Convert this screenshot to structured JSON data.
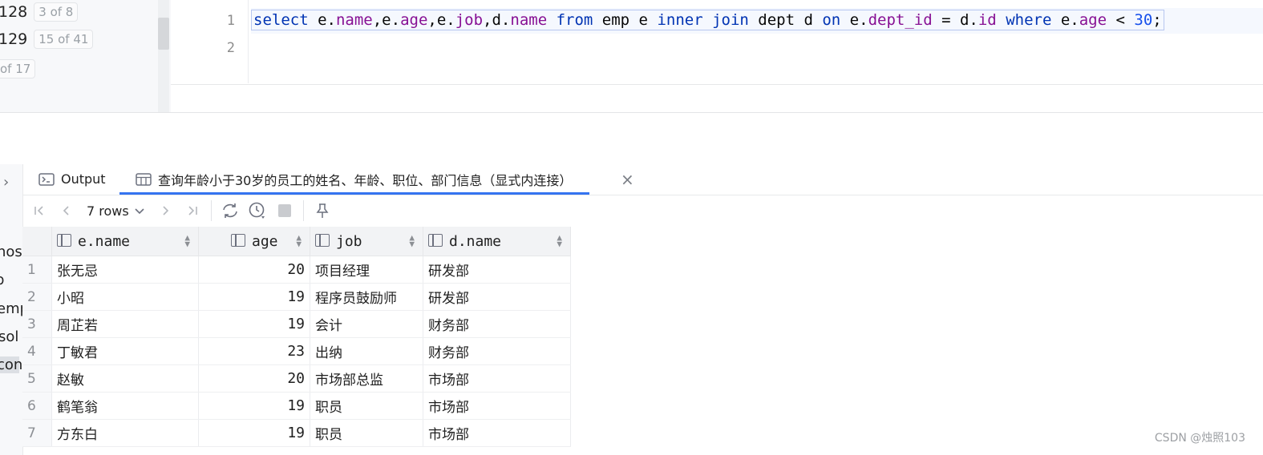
{
  "history": [
    {
      "num": "128",
      "badge": "3 of 8"
    },
    {
      "num": "129",
      "badge": "15 of 41"
    },
    {
      "num": "",
      "badge": "of 17"
    }
  ],
  "editor": {
    "line_numbers": [
      "1",
      "2"
    ]
  },
  "tabs": {
    "output_label": "Output",
    "result_label": "查询年龄小于30岁的员工的姓名、年龄、职位、部门信息（显式内连接）",
    "close_symbol": "×"
  },
  "toolbar": {
    "rows_label": "7 rows"
  },
  "tree_fragments": [
    "hos",
    "p",
    "emp",
    "sol",
    "cons"
  ],
  "table": {
    "columns": [
      "e.name",
      "age",
      "job",
      "d.name"
    ],
    "rows": [
      {
        "n": "1",
        "name": "张无忌",
        "age": "20",
        "job": "项目经理",
        "dept": "研发部"
      },
      {
        "n": "2",
        "name": "小昭",
        "age": "19",
        "job": "程序员鼓励师",
        "dept": "研发部"
      },
      {
        "n": "3",
        "name": "周芷若",
        "age": "19",
        "job": "会计",
        "dept": "财务部"
      },
      {
        "n": "4",
        "name": "丁敏君",
        "age": "23",
        "job": "出纳",
        "dept": "财务部"
      },
      {
        "n": "5",
        "name": "赵敏",
        "age": "20",
        "job": "市场部总监",
        "dept": "市场部"
      },
      {
        "n": "6",
        "name": "鹤笔翁",
        "age": "19",
        "job": "职员",
        "dept": "市场部"
      },
      {
        "n": "7",
        "name": "方东白",
        "age": "19",
        "job": "职员",
        "dept": "市场部"
      }
    ]
  },
  "watermark": "CSDN @烛照103",
  "colors": {
    "accent": "#3574f0",
    "keyword": "#0033b3",
    "field": "#871094",
    "number": "#1750eb"
  }
}
